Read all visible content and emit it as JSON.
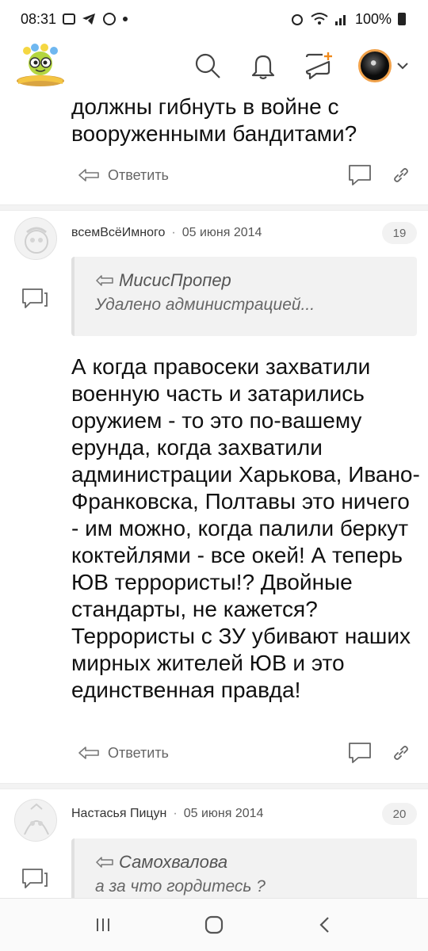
{
  "status_bar": {
    "time": "08:31",
    "battery": "100%"
  },
  "header": {
    "icons": [
      "search-icon",
      "bell-icon",
      "new-post-icon",
      "avatar",
      "chevron-down-icon"
    ]
  },
  "top_comment": {
    "text": "должны гибнуть в войне с вооруженными бандитами?",
    "reply_label": "Ответить"
  },
  "comment1": {
    "author": "всемВсёИмного",
    "sep": "·",
    "date": "05 июня 2014",
    "number": "19",
    "quote_author": "МисисПропер",
    "quote_text": "Удалено администрацией...",
    "text": "А когда правосеки захватили военную часть и затарились оружием - то это по-вашему ерунда, когда захватили администрации Харькова, Ивано-Франковска, Полтавы это ничего - им можно, когда палили беркут коктейлями - все окей! А теперь ЮВ террористы!? Двойные стандарты, не кажется? Террористы с ЗУ убивают наших мирных жителей ЮВ и это единственная правда!",
    "reply_label": "Ответить"
  },
  "comment2": {
    "author": "Настасья Пицун",
    "sep": "·",
    "date": "05 июня 2014",
    "number": "20",
    "quote_author": "Самохвалова",
    "quote_text": "а за что гордитесь ?"
  },
  "colors": {
    "accent_logo": "#f4c542",
    "divider": "#f3f3f3",
    "quote_bg": "#f2f2f2"
  }
}
